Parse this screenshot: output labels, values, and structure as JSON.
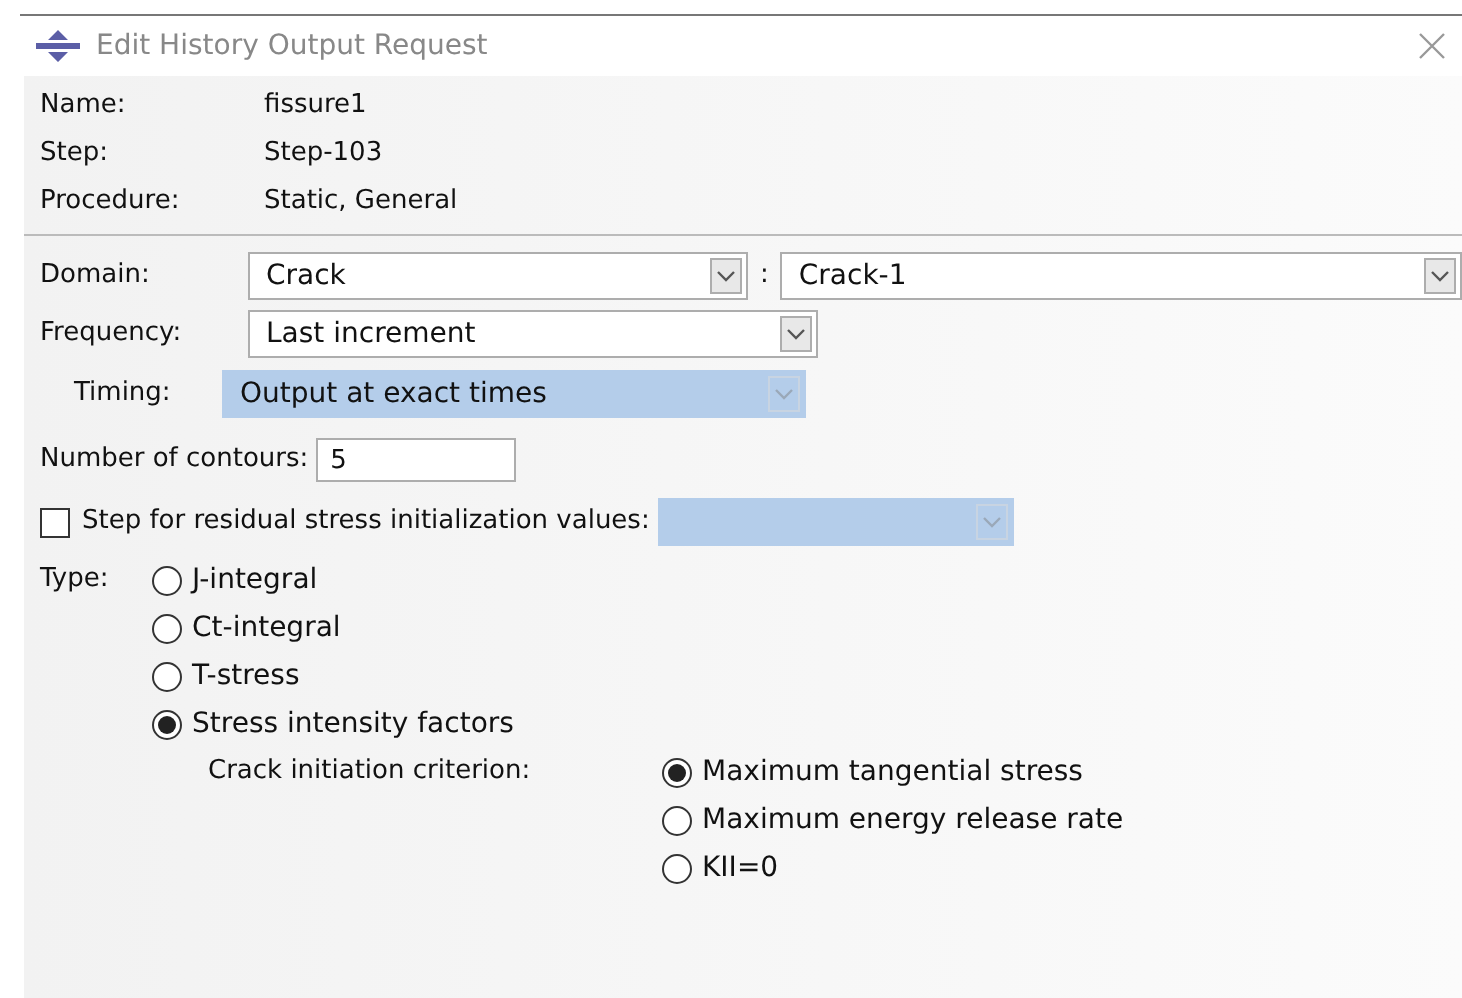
{
  "window": {
    "title": "Edit History Output Request"
  },
  "info": [
    {
      "label": "Name:",
      "value": "fissure1"
    },
    {
      "label": "Step:",
      "value": "Step-103"
    },
    {
      "label": "Procedure:",
      "value": "Static, General"
    }
  ],
  "domain": {
    "label": "Domain:",
    "value": "Crack",
    "separator": ":",
    "region": "Crack-1"
  },
  "frequency": {
    "label": "Frequency:",
    "value": "Last increment"
  },
  "timing": {
    "label": "Timing:",
    "value": "Output at exact times",
    "disabled": true
  },
  "contours": {
    "label": "Number of contours:",
    "value": "5"
  },
  "residual": {
    "label": "Step for residual stress initialization values:",
    "checked": false,
    "disabled": true
  },
  "type": {
    "label": "Type:",
    "options": [
      {
        "label": "J-integral",
        "selected": false
      },
      {
        "label": "Ct-integral",
        "selected": false
      },
      {
        "label": "T-stress",
        "selected": false
      },
      {
        "label": "Stress intensity factors",
        "selected": true
      }
    ]
  },
  "criterion": {
    "label": "Crack initiation criterion:",
    "options": [
      {
        "label": "Maximum tangential stress",
        "selected": true
      },
      {
        "label": "Maximum energy release rate",
        "selected": false
      },
      {
        "label": "KII=0",
        "selected": false
      }
    ]
  }
}
